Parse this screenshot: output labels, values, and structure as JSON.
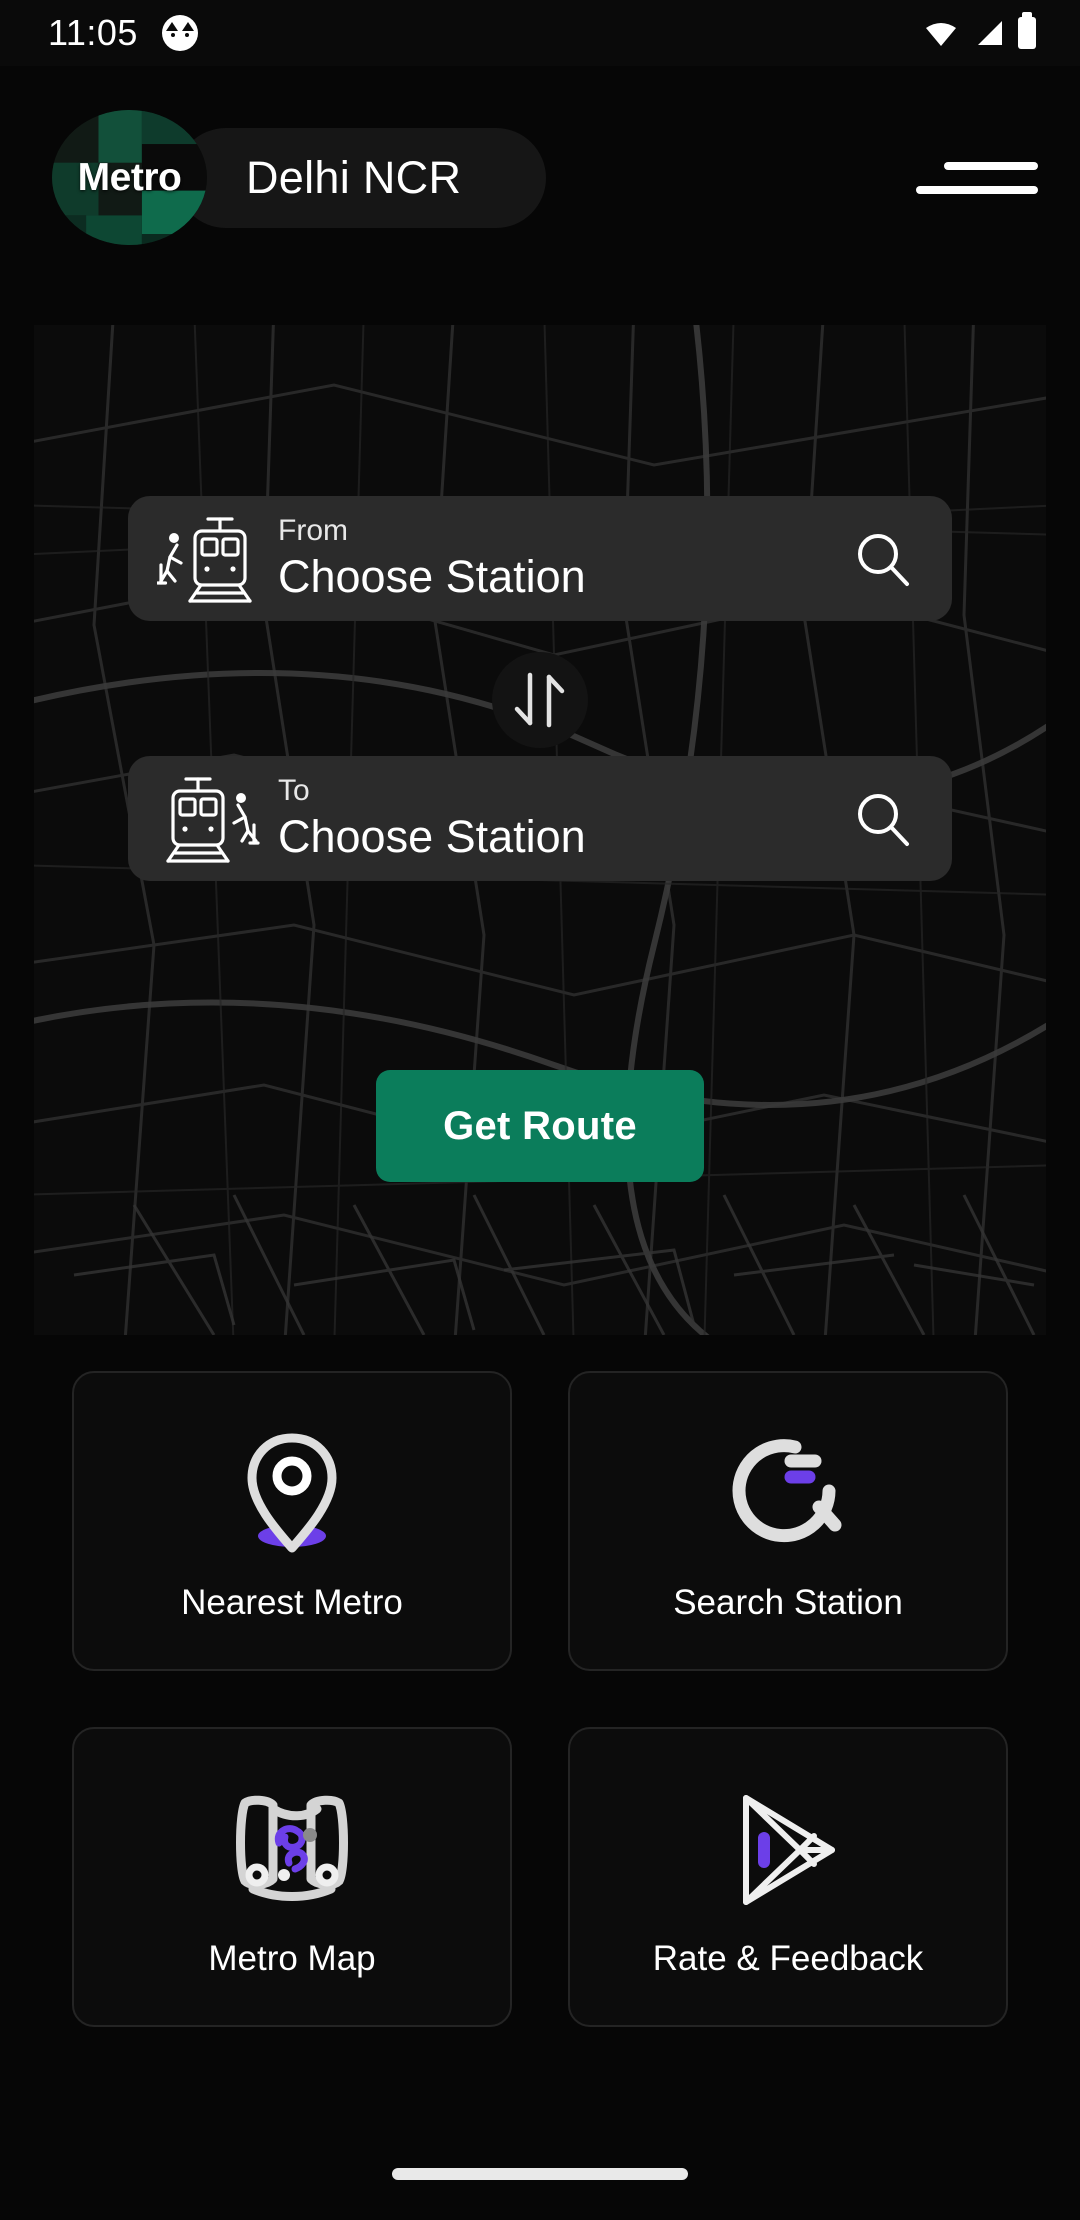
{
  "status_bar": {
    "time": "11:05",
    "app_icon": "cat-app-icon",
    "wifi_icon": "wifi-icon",
    "signal_icon": "cellular-signal-icon",
    "battery_icon": "battery-icon"
  },
  "header": {
    "logo_text": "Metro",
    "city": "Delhi NCR",
    "menu_icon": "hamburger-menu-icon"
  },
  "route_planner": {
    "from": {
      "label": "From",
      "value": "Choose Station",
      "icon": "train-departure-icon",
      "search_icon": "search-icon"
    },
    "to": {
      "label": "To",
      "value": "Choose Station",
      "icon": "train-arrival-icon",
      "search_icon": "search-icon"
    },
    "swap_icon": "swap-vertical-icon",
    "submit_label": "Get Route"
  },
  "tiles": [
    {
      "label": "Nearest Metro",
      "icon": "location-pin-icon"
    },
    {
      "label": "Search Station",
      "icon": "search-circle-icon"
    },
    {
      "label": "Metro Map",
      "icon": "map-scroll-icon"
    },
    {
      "label": "Rate & Feedback",
      "icon": "play-store-icon"
    }
  ],
  "colors": {
    "accent_green": "#0b7d5b",
    "accent_purple": "#6c3fe8",
    "card_bg": "#2b2b2b",
    "tile_bg": "#0c0c0c",
    "page_bg": "#060606"
  },
  "nav_bar": {
    "handle": "home-indicator"
  }
}
